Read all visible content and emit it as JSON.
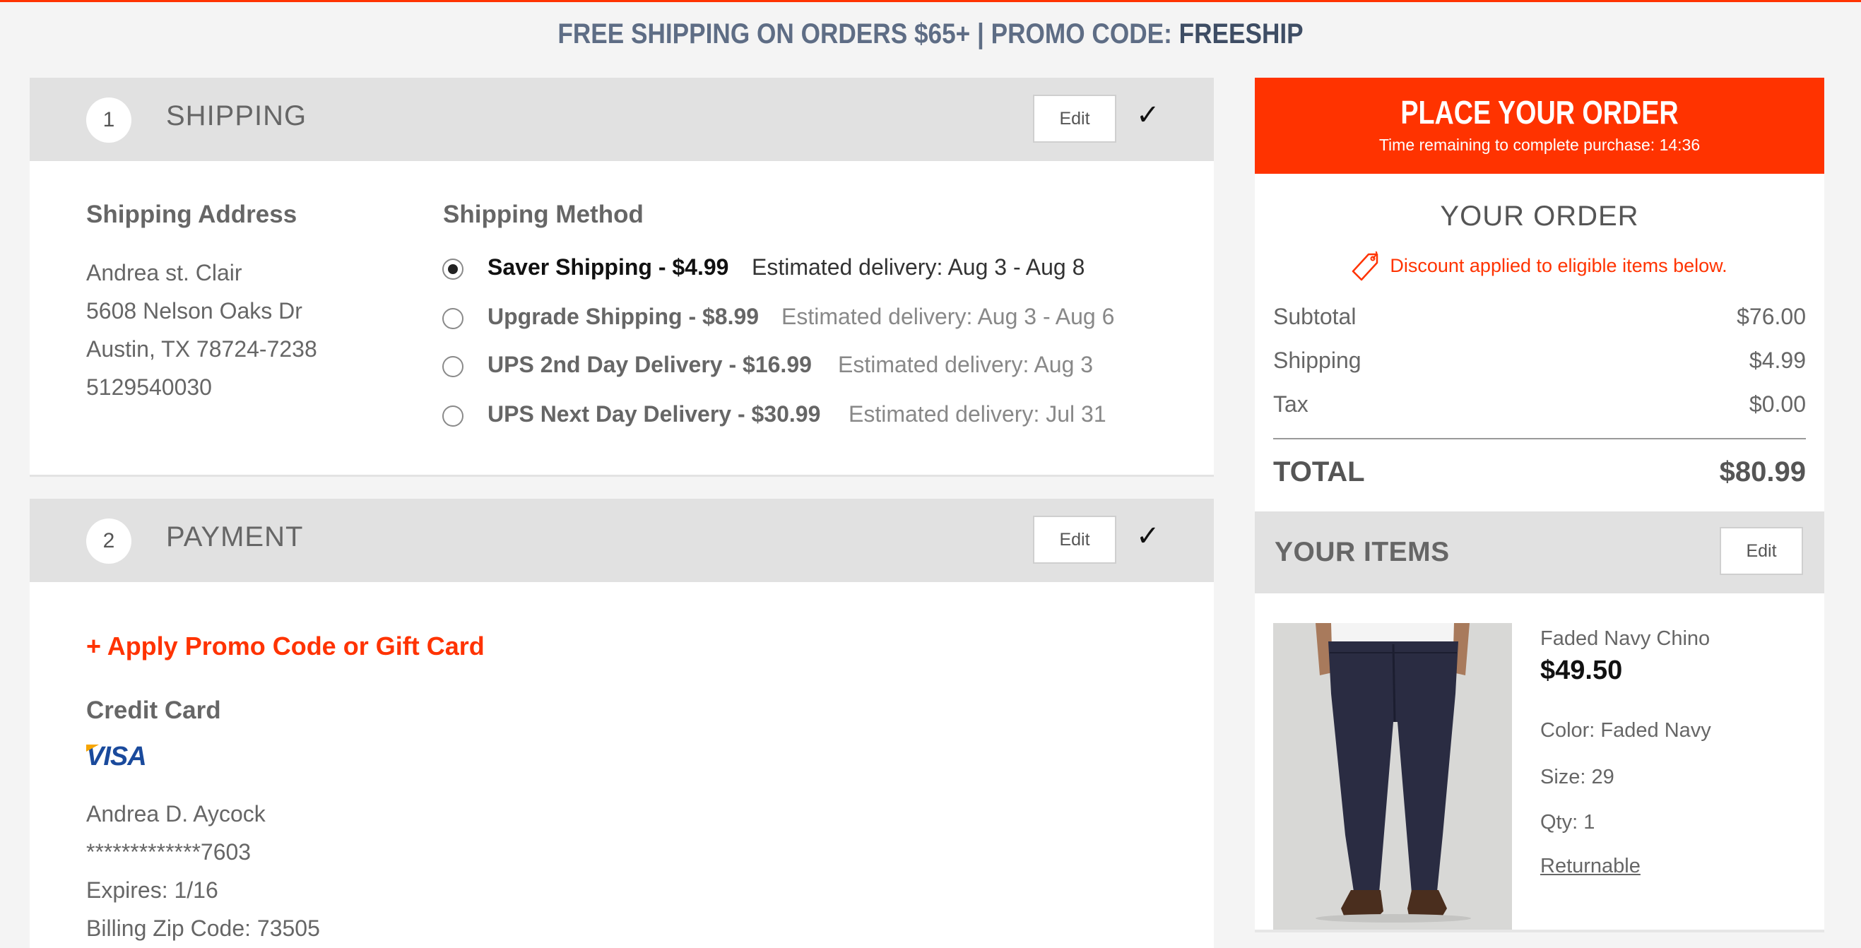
{
  "banner": {
    "text": "FREE SHIPPING ON ORDERS $65+ | PROMO CODE: ",
    "code": "FREESHIP"
  },
  "shipping_section": {
    "step": "1",
    "title": "SHIPPING",
    "edit_label": "Edit",
    "check": "✓",
    "address_label": "Shipping Address",
    "address": [
      "Andrea st. Clair",
      "5608 Nelson Oaks Dr",
      "Austin, TX 78724-7238",
      "5129540030"
    ],
    "method_label": "Shipping Method",
    "methods": [
      {
        "name": "Saver Shipping - $4.99",
        "estimate": "Estimated delivery: Aug 3 - Aug 8",
        "selected": true
      },
      {
        "name": "Upgrade Shipping - $8.99",
        "estimate": "Estimated delivery: Aug 3 - Aug 6",
        "selected": false
      },
      {
        "name": "UPS 2nd Day Delivery - $16.99",
        "estimate": "Estimated delivery: Aug 3",
        "selected": false
      },
      {
        "name": "UPS Next Day Delivery - $30.99",
        "estimate": "Estimated delivery: Jul 31",
        "selected": false
      }
    ]
  },
  "payment_section": {
    "step": "2",
    "title": "PAYMENT",
    "edit_label": "Edit",
    "check": "✓",
    "promo_link": "+ Apply Promo Code or Gift Card",
    "card_label": "Credit Card",
    "card_brand": "VISA",
    "card_lines": [
      "Andrea D. Aycock",
      "*************7603",
      "Expires: 1/16",
      "Billing Zip Code: 73505"
    ]
  },
  "order": {
    "place_order_label": "PLACE YOUR ORDER",
    "timer_text": "Time remaining to complete purchase: 14:36",
    "your_order_title": "YOUR ORDER",
    "discount_text": "Discount applied to eligible items below.",
    "rows": [
      {
        "label": "Subtotal",
        "value": "$76.00"
      },
      {
        "label": "Shipping",
        "value": "$4.99"
      },
      {
        "label": "Tax",
        "value": "$0.00"
      }
    ],
    "total_label": "TOTAL",
    "total_value": "$80.99"
  },
  "items": {
    "title": "YOUR ITEMS",
    "edit_label": "Edit",
    "list": [
      {
        "name": "Faded Navy Chino",
        "price": "$49.50",
        "color": "Color: Faded Navy",
        "size": "Size: 29",
        "qty": "Qty: 1",
        "returnable": "Returnable"
      }
    ]
  },
  "colors": {
    "accent": "#ff3300",
    "banner_text": "#5e6d85",
    "section_header": "#e1e1e1",
    "page_bg": "#f4f4f4"
  },
  "icons": [
    "check-icon",
    "radio-selected-icon",
    "radio-unselected-icon",
    "price-tag-icon",
    "visa-logo"
  ]
}
